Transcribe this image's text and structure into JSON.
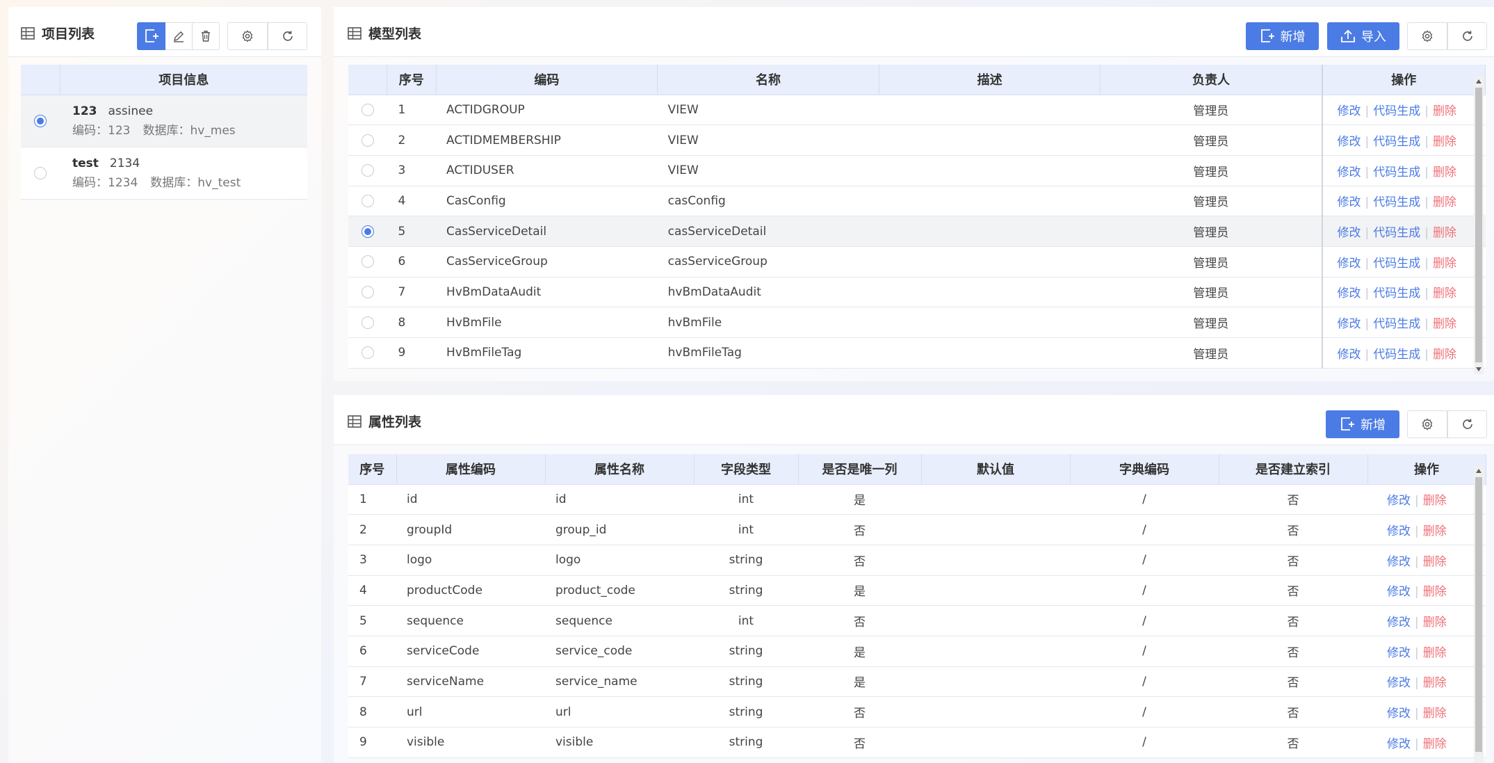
{
  "left": {
    "title": "项目列表",
    "header": "项目信息",
    "items": [
      {
        "name": "123",
        "desc": "assinee",
        "code_label": "编码：",
        "code": "123",
        "db_label": "数据库：",
        "db": "hv_mes",
        "selected": true
      },
      {
        "name": "test",
        "desc": "2134",
        "code_label": "编码：",
        "code": "1234",
        "db_label": "数据库：",
        "db": "hv_test",
        "selected": false
      }
    ]
  },
  "model": {
    "title": "模型列表",
    "add_label": "新增",
    "import_label": "导入",
    "columns": [
      "序号",
      "编码",
      "名称",
      "描述",
      "负责人",
      "操作"
    ],
    "actions": {
      "edit": "修改",
      "gen": "代码生成",
      "delete": "删除"
    },
    "rows": [
      {
        "no": "1",
        "code": "ACTIDGROUP",
        "name": "VIEW",
        "desc": "",
        "owner": "管理员",
        "selected": false
      },
      {
        "no": "2",
        "code": "ACTIDMEMBERSHIP",
        "name": "VIEW",
        "desc": "",
        "owner": "管理员",
        "selected": false
      },
      {
        "no": "3",
        "code": "ACTIDUSER",
        "name": "VIEW",
        "desc": "",
        "owner": "管理员",
        "selected": false
      },
      {
        "no": "4",
        "code": "CasConfig",
        "name": "casConfig",
        "desc": "",
        "owner": "管理员",
        "selected": false
      },
      {
        "no": "5",
        "code": "CasServiceDetail",
        "name": "casServiceDetail",
        "desc": "",
        "owner": "管理员",
        "selected": true
      },
      {
        "no": "6",
        "code": "CasServiceGroup",
        "name": "casServiceGroup",
        "desc": "",
        "owner": "管理员",
        "selected": false
      },
      {
        "no": "7",
        "code": "HvBmDataAudit",
        "name": "hvBmDataAudit",
        "desc": "",
        "owner": "管理员",
        "selected": false
      },
      {
        "no": "8",
        "code": "HvBmFile",
        "name": "hvBmFile",
        "desc": "",
        "owner": "管理员",
        "selected": false
      },
      {
        "no": "9",
        "code": "HvBmFileTag",
        "name": "hvBmFileTag",
        "desc": "",
        "owner": "管理员",
        "selected": false
      }
    ]
  },
  "attr": {
    "title": "属性列表",
    "add_label": "新增",
    "columns": [
      "序号",
      "属性编码",
      "属性名称",
      "字段类型",
      "是否是唯一列",
      "默认值",
      "字典编码",
      "是否建立索引",
      "操作"
    ],
    "actions": {
      "edit": "修改",
      "delete": "删除"
    },
    "rows": [
      {
        "no": "1",
        "code": "id",
        "name": "id",
        "type": "int",
        "unique": "是",
        "default": "",
        "dict": "/",
        "index": "否"
      },
      {
        "no": "2",
        "code": "groupId",
        "name": "group_id",
        "type": "int",
        "unique": "否",
        "default": "",
        "dict": "/",
        "index": "否"
      },
      {
        "no": "3",
        "code": "logo",
        "name": "logo",
        "type": "string",
        "unique": "否",
        "default": "",
        "dict": "/",
        "index": "否"
      },
      {
        "no": "4",
        "code": "productCode",
        "name": "product_code",
        "type": "string",
        "unique": "是",
        "default": "",
        "dict": "/",
        "index": "否"
      },
      {
        "no": "5",
        "code": "sequence",
        "name": "sequence",
        "type": "int",
        "unique": "否",
        "default": "",
        "dict": "/",
        "index": "否"
      },
      {
        "no": "6",
        "code": "serviceCode",
        "name": "service_code",
        "type": "string",
        "unique": "是",
        "default": "",
        "dict": "/",
        "index": "否"
      },
      {
        "no": "7",
        "code": "serviceName",
        "name": "service_name",
        "type": "string",
        "unique": "是",
        "default": "",
        "dict": "/",
        "index": "否"
      },
      {
        "no": "8",
        "code": "url",
        "name": "url",
        "type": "string",
        "unique": "否",
        "default": "",
        "dict": "/",
        "index": "否"
      },
      {
        "no": "9",
        "code": "visible",
        "name": "visible",
        "type": "string",
        "unique": "否",
        "default": "",
        "dict": "/",
        "index": "否"
      }
    ]
  },
  "colors": {
    "primary": "#4b7be5",
    "danger": "#f07178",
    "header_bg": "#e8eefb"
  }
}
